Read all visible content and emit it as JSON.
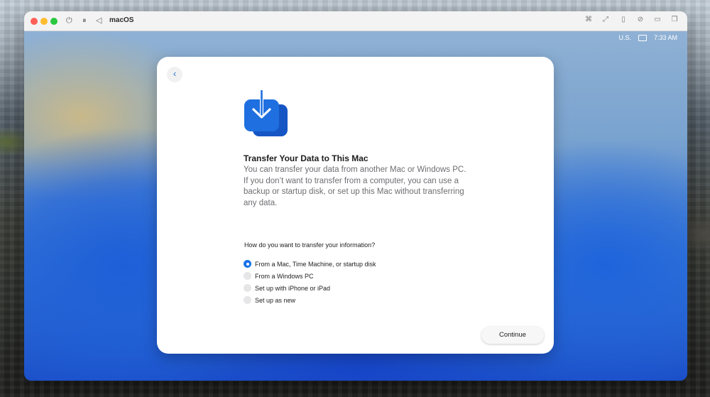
{
  "window": {
    "title": "macOS"
  },
  "status_bar": {
    "input_source": "U.S.",
    "time": "7:33 AM"
  },
  "dialog": {
    "headline": "Transfer Your Data to This Mac",
    "description": "You can transfer your data from another Mac or Windows PC. If you don’t want to transfer from a computer, you can use a backup or startup disk, or set up this Mac without transferring any data.",
    "question": "How do you want to transfer your information?",
    "options": [
      {
        "label": "From a Mac, Time Machine, or startup disk",
        "selected": true
      },
      {
        "label": "From a Windows PC",
        "selected": false
      },
      {
        "label": "Set up with iPhone or iPad",
        "selected": false
      },
      {
        "label": "Set up as new",
        "selected": false
      }
    ],
    "continue_label": "Continue"
  },
  "colors": {
    "accent": "#1a73e8",
    "icon_blue": "#1f6fe0"
  },
  "icons": {
    "back": "chevron-left-icon",
    "migrate": "migration-assistant-icon"
  }
}
